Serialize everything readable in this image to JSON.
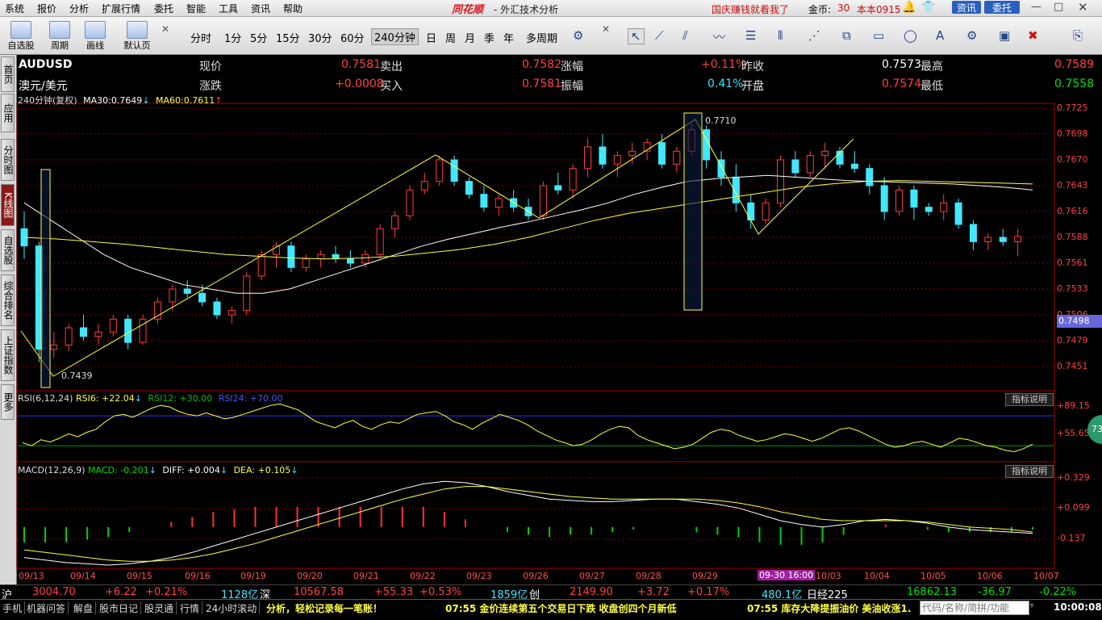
{
  "app": {
    "brand": "同花顺",
    "title": "- 外汇技术分析",
    "promo": "国庆赚钱就看我了",
    "coins_label": "金币:",
    "coins_value": "30",
    "version": "本本0915",
    "news_btn": "资讯",
    "trade_btn": "委托"
  },
  "menu": [
    "系统",
    "报价",
    "分析",
    "扩展行情",
    "委托",
    "智能",
    "工具",
    "资讯",
    "帮助"
  ],
  "toolbar": {
    "buttons": [
      {
        "label": "自选股",
        "icon": "star-list-icon"
      },
      {
        "label": "周期",
        "icon": "clock-icon"
      },
      {
        "label": "画线",
        "icon": "pencil-icon"
      },
      {
        "label": "默认页",
        "icon": "home-icon"
      }
    ],
    "periods": [
      "分时",
      "1分",
      "5分",
      "15分",
      "30分",
      "60分",
      "240分钟",
      "日",
      "周",
      "月",
      "季",
      "年",
      "多周期"
    ],
    "active_period": "240分钟"
  },
  "sidebar": [
    "首页",
    "应用",
    "分时图",
    "K线图",
    "自选股",
    "综合排名",
    "上证指数",
    "更多"
  ],
  "sidebar_active": "K线图",
  "quote": {
    "symbol": "AUDUSD",
    "name": "澳元/美元",
    "rows": [
      [
        {
          "label": "现价",
          "value": "0.7581",
          "color": "red"
        },
        {
          "label": "卖出",
          "value": "0.7582",
          "color": "red"
        },
        {
          "label": "涨幅",
          "value": "+0.11%",
          "color": "red"
        },
        {
          "label": "昨收",
          "value": "0.7573",
          "color": "white"
        },
        {
          "label": "最高",
          "value": "0.7589",
          "color": "red"
        }
      ],
      [
        {
          "label": "涨跌",
          "value": "+0.0008",
          "color": "red"
        },
        {
          "label": "买入",
          "value": "0.7581",
          "color": "red"
        },
        {
          "label": "振幅",
          "value": "0.41%",
          "color": "cyan"
        },
        {
          "label": "开盘",
          "value": "0.7574",
          "color": "red"
        },
        {
          "label": "最低",
          "value": "0.7558",
          "color": "green"
        }
      ]
    ]
  },
  "main_panel": {
    "period_label": "240分钟(复权)",
    "ma30_label": "MA30:",
    "ma30_value": "0.7649",
    "ma30_arrow": "↓",
    "ma60_label": "MA60:",
    "ma60_value": "0.7611",
    "ma60_arrow": "↑",
    "high_marker": "0.7710",
    "low_marker": "0.7439",
    "current_price_tag": "0.7498"
  },
  "rsi_panel": {
    "label": "RSI(6,12,24)",
    "rsi6": "RSI6: +22.04",
    "rsi6_arrow": "↓",
    "rsi12": "RSI12: +30.00",
    "rsi24": "RSI24: +70.00",
    "button": "指标说明",
    "badge": "73"
  },
  "macd_panel": {
    "label": "MACD(12,26,9)",
    "macd": "MACD: -0.201",
    "macd_arrow": "↓",
    "diff": "DIFF: +0.004",
    "diff_arrow": "↓",
    "dea": "DEA: +0.105",
    "dea_arrow": "↓",
    "button": "指标说明"
  },
  "date_axis": {
    "labels": [
      "09/13",
      "09/14",
      "09/15",
      "09/16",
      "09/19",
      "09/20",
      "09/21",
      "09/22",
      "09/23",
      "09/26",
      "09/27",
      "09/28",
      "09/29",
      "09-30 16:00",
      "10/03",
      "10/04",
      "10/05",
      "10/06",
      "10/07"
    ]
  },
  "chart_data": [
    {
      "type": "candlestick",
      "name": "AUDUSD 240分钟",
      "y_axis_ticks": [
        "0.7725",
        "0.7698",
        "0.7670",
        "0.7643",
        "0.7616",
        "0.7588",
        "0.7561",
        "0.7533",
        "0.7506",
        "0.7479",
        "0.7451"
      ],
      "ylim": [
        0.743,
        0.773
      ],
      "candles": [
        [
          0.759,
          0.761,
          0.7555,
          0.757
        ],
        [
          0.757,
          0.7575,
          0.7435,
          0.745
        ],
        [
          0.745,
          0.747,
          0.744,
          0.7455
        ],
        [
          0.7455,
          0.748,
          0.7448,
          0.7475
        ],
        [
          0.7475,
          0.749,
          0.746,
          0.7465
        ],
        [
          0.7465,
          0.748,
          0.7455,
          0.747
        ],
        [
          0.747,
          0.749,
          0.7465,
          0.7485
        ],
        [
          0.7485,
          0.749,
          0.745,
          0.7458
        ],
        [
          0.7458,
          0.749,
          0.7455,
          0.7485
        ],
        [
          0.7485,
          0.751,
          0.748,
          0.7505
        ],
        [
          0.7505,
          0.7525,
          0.7495,
          0.752
        ],
        [
          0.752,
          0.753,
          0.751,
          0.7515
        ],
        [
          0.7515,
          0.7525,
          0.75,
          0.7505
        ],
        [
          0.7505,
          0.751,
          0.7485,
          0.749
        ],
        [
          0.749,
          0.75,
          0.748,
          0.7495
        ],
        [
          0.7495,
          0.754,
          0.749,
          0.7535
        ],
        [
          0.7535,
          0.7565,
          0.753,
          0.756
        ],
        [
          0.756,
          0.7575,
          0.7545,
          0.757
        ],
        [
          0.757,
          0.7575,
          0.754,
          0.7545
        ],
        [
          0.7545,
          0.756,
          0.754,
          0.7555
        ],
        [
          0.7555,
          0.7565,
          0.7545,
          0.756
        ],
        [
          0.756,
          0.757,
          0.755,
          0.7555
        ],
        [
          0.7555,
          0.7565,
          0.7545,
          0.755
        ],
        [
          0.755,
          0.7565,
          0.7545,
          0.756
        ],
        [
          0.756,
          0.7595,
          0.7555,
          0.759
        ],
        [
          0.759,
          0.761,
          0.758,
          0.7605
        ],
        [
          0.7605,
          0.764,
          0.76,
          0.7635
        ],
        [
          0.7635,
          0.7655,
          0.763,
          0.7645
        ],
        [
          0.7645,
          0.7675,
          0.764,
          0.767
        ],
        [
          0.767,
          0.7675,
          0.764,
          0.7645
        ],
        [
          0.7645,
          0.765,
          0.7625,
          0.763
        ],
        [
          0.763,
          0.764,
          0.761,
          0.7615
        ],
        [
          0.7615,
          0.763,
          0.7605,
          0.7625
        ],
        [
          0.7625,
          0.7635,
          0.761,
          0.7615
        ],
        [
          0.7615,
          0.7625,
          0.76,
          0.7605
        ],
        [
          0.7605,
          0.7645,
          0.76,
          0.764
        ],
        [
          0.764,
          0.7655,
          0.763,
          0.7635
        ],
        [
          0.7635,
          0.7665,
          0.7625,
          0.766
        ],
        [
          0.766,
          0.7695,
          0.765,
          0.7685
        ],
        [
          0.7685,
          0.77,
          0.766,
          0.7665
        ],
        [
          0.7665,
          0.768,
          0.765,
          0.7675
        ],
        [
          0.7675,
          0.769,
          0.7665,
          0.768
        ],
        [
          0.768,
          0.7695,
          0.767,
          0.769
        ],
        [
          0.769,
          0.77,
          0.766,
          0.7665
        ],
        [
          0.7665,
          0.7685,
          0.7655,
          0.768
        ],
        [
          0.768,
          0.7712,
          0.7675,
          0.7705
        ],
        [
          0.7705,
          0.771,
          0.766,
          0.767
        ],
        [
          0.767,
          0.768,
          0.764,
          0.765
        ],
        [
          0.765,
          0.7665,
          0.761,
          0.762
        ],
        [
          0.762,
          0.763,
          0.759,
          0.76
        ],
        [
          0.76,
          0.7625,
          0.7595,
          0.762
        ],
        [
          0.762,
          0.7675,
          0.7615,
          0.767
        ],
        [
          0.767,
          0.768,
          0.765,
          0.7655
        ],
        [
          0.7655,
          0.768,
          0.765,
          0.7675
        ],
        [
          0.7675,
          0.769,
          0.766,
          0.768
        ],
        [
          0.768,
          0.7685,
          0.766,
          0.7665
        ],
        [
          0.7665,
          0.768,
          0.7655,
          0.766
        ],
        [
          0.766,
          0.7665,
          0.763,
          0.764
        ],
        [
          0.764,
          0.765,
          0.76,
          0.761
        ],
        [
          0.761,
          0.764,
          0.7605,
          0.7635
        ],
        [
          0.7635,
          0.764,
          0.76,
          0.7615
        ],
        [
          0.7615,
          0.762,
          0.7605,
          0.761
        ],
        [
          0.761,
          0.763,
          0.76,
          0.762
        ],
        [
          0.762,
          0.7625,
          0.759,
          0.7595
        ],
        [
          0.7595,
          0.76,
          0.7565,
          0.7575
        ],
        [
          0.7575,
          0.7585,
          0.7565,
          0.758
        ],
        [
          0.758,
          0.759,
          0.757,
          0.7575
        ],
        [
          0.7575,
          0.759,
          0.7558,
          0.7581
        ]
      ],
      "ma30": [
        0.762,
        0.76,
        0.758,
        0.756,
        0.7545,
        0.7535,
        0.7525,
        0.752,
        0.7515,
        0.7515,
        0.752,
        0.753,
        0.754,
        0.755,
        0.756,
        0.757,
        0.7578,
        0.7585,
        0.7592,
        0.7598,
        0.7605,
        0.7612,
        0.762,
        0.763,
        0.7638,
        0.7645,
        0.7648,
        0.765,
        0.7652,
        0.765,
        0.7648,
        0.7646,
        0.7645,
        0.7644,
        0.7643,
        0.7642,
        0.764,
        0.7638,
        0.7635
      ],
      "ma60": [
        0.758,
        0.7578,
        0.7575,
        0.7572,
        0.7568,
        0.7564,
        0.756,
        0.7558,
        0.7556,
        0.7555,
        0.7556,
        0.7558,
        0.7562,
        0.7566,
        0.7572,
        0.758,
        0.759,
        0.76,
        0.7608,
        0.7614,
        0.762,
        0.7626,
        0.7632,
        0.7638,
        0.7642,
        0.7645,
        0.7646,
        0.7645,
        0.7644,
        0.7643,
        0.7642
      ]
    },
    {
      "type": "line",
      "name": "RSI",
      "y_axis_ticks": [
        "+89.15",
        "+55.65"
      ],
      "ylim": [
        15,
        95
      ],
      "levels": [
        70,
        30
      ],
      "values": [
        34,
        30,
        38,
        35,
        40,
        46,
        42,
        48,
        52,
        62,
        70,
        72,
        68,
        74,
        80,
        84,
        82,
        76,
        72,
        70,
        74,
        70,
        66,
        68,
        72,
        76,
        80,
        84,
        86,
        82,
        78,
        70,
        62,
        58,
        54,
        60,
        64,
        56,
        52,
        58,
        62,
        60,
        66,
        72,
        74,
        76,
        70,
        62,
        58,
        52,
        60,
        66,
        72,
        68,
        64,
        58,
        50,
        44,
        38,
        34,
        30,
        32,
        38,
        46,
        52,
        56,
        54,
        44,
        38,
        34,
        30,
        26,
        28,
        32,
        40,
        48,
        52,
        50,
        44,
        40,
        36,
        38,
        42,
        46,
        44,
        40,
        36,
        40,
        46,
        52,
        54,
        50,
        44,
        38,
        32,
        28,
        30,
        34,
        36,
        32,
        28,
        34,
        40,
        38,
        34,
        30,
        28,
        24,
        22,
        26,
        32
      ]
    },
    {
      "type": "bar_line",
      "name": "MACD",
      "y_axis_ticks": [
        "+0.329",
        "+0.099",
        "-0.137"
      ],
      "ylim": [
        -0.3,
        0.4
      ],
      "diff": [
        -0.24,
        -0.26,
        -0.28,
        -0.29,
        -0.3,
        -0.29,
        -0.27,
        -0.24,
        -0.2,
        -0.15,
        -0.1,
        -0.05,
        0.0,
        0.05,
        0.1,
        0.15,
        0.2,
        0.25,
        0.3,
        0.34,
        0.36,
        0.35,
        0.32,
        0.28,
        0.25,
        0.22,
        0.21,
        0.2,
        0.2,
        0.21,
        0.22,
        0.22,
        0.2,
        0.18,
        0.15,
        0.1,
        0.05,
        0.02,
        0.0,
        0.02,
        0.05,
        0.06,
        0.05,
        0.03,
        0.0,
        -0.02,
        -0.03,
        -0.04,
        -0.05
      ],
      "dea": [
        -0.18,
        -0.2,
        -0.22,
        -0.24,
        -0.26,
        -0.27,
        -0.27,
        -0.26,
        -0.24,
        -0.21,
        -0.17,
        -0.13,
        -0.08,
        -0.03,
        0.02,
        0.07,
        0.12,
        0.17,
        0.22,
        0.26,
        0.3,
        0.32,
        0.32,
        0.3,
        0.28,
        0.26,
        0.24,
        0.23,
        0.22,
        0.22,
        0.22,
        0.22,
        0.22,
        0.21,
        0.19,
        0.16,
        0.12,
        0.09,
        0.06,
        0.05,
        0.05,
        0.05,
        0.05,
        0.04,
        0.02,
        0.0,
        -0.01,
        -0.02,
        -0.04
      ]
    }
  ],
  "status_line1": {
    "sh_label": "沪",
    "sh_value": "3004.70",
    "sh_change": "+6.22",
    "sh_pct": "+0.21%",
    "sh_vol": "1128亿",
    "sz_label": "深",
    "sz_value": "10567.58",
    "sz_change": "+55.33",
    "sz_pct": "+0.53%",
    "sz_vol": "1859亿",
    "cy_label": "创",
    "cy_value": "2149.90",
    "cy_change": "+3.72",
    "cy_pct": "+0.17%",
    "cy_vol": "480.1亿",
    "rj_label": "日经225",
    "rj_value": "16862.13",
    "rj_change": "-36.97",
    "rj_pct": "-0.22%"
  },
  "status_line2": {
    "tabs": [
      "手机",
      "机器问答",
      "解盘",
      "股市日记",
      "股灵通",
      "行情",
      "24小时滚动"
    ],
    "ticker1": "分析，轻松记录每一笔账！",
    "ticker2": "07:55 金价连续第五个交易日下跌 收盘创四个月新低",
    "ticker3": "07:55 库存大降提振油价 美油收涨1.",
    "search_placeholder": "代码/名称/简拼/功能",
    "clock": "10:00:08"
  },
  "colors": {
    "up": "#ff3c3c",
    "down": "#40e8ff",
    "ma30": "#ffffff",
    "ma60": "#ffff40",
    "rsi_upper": "#3030ff",
    "rsi_lower": "#00a000"
  }
}
